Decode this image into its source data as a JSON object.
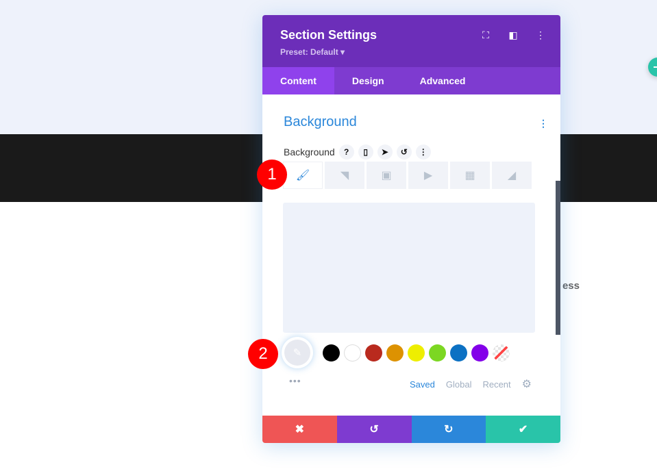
{
  "page": {
    "partial_text": "ess"
  },
  "modal": {
    "title": "Section Settings",
    "preset": "Preset: Default ▾",
    "header_icons": [
      "fullscreen-icon",
      "columns-icon",
      "more-vertical-icon"
    ],
    "tabs": [
      {
        "label": "Content",
        "active": true
      },
      {
        "label": "Design"
      },
      {
        "label": "Advanced"
      }
    ],
    "section_title": "Background",
    "field_label": "Background",
    "field_icons": [
      "help-icon",
      "mobile-icon",
      "pointer-icon",
      "reset-icon",
      "more-icon"
    ],
    "bg_tabs": [
      "color-icon",
      "gradient-icon",
      "image-icon",
      "video-icon",
      "pattern-icon",
      "mask-icon"
    ],
    "swatches": [
      "#000000",
      "#ffffff",
      "#b92a1e",
      "#dd9201",
      "#eeee00",
      "#7cd722",
      "#0c71c3",
      "#8300e9",
      "transparent"
    ],
    "palette_tabs": [
      {
        "label": "Saved",
        "active": true
      },
      {
        "label": "Global"
      },
      {
        "label": "Recent"
      }
    ],
    "footer": {
      "colors": [
        "#ef5555",
        "#7e3bd0",
        "#2b87da",
        "#29c4a9"
      ]
    }
  },
  "badges": [
    "1",
    "2"
  ]
}
